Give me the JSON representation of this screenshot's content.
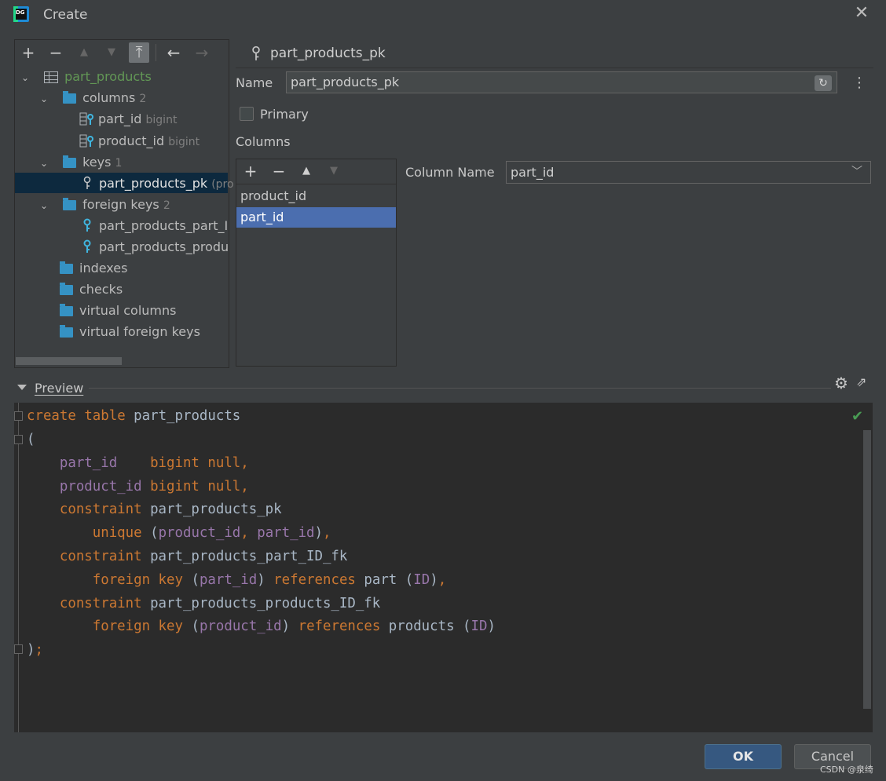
{
  "window": {
    "title": "Create",
    "close_icon": "close-icon"
  },
  "tree": {
    "toolbar": [
      "add-icon",
      "remove-icon",
      "move-up-icon",
      "move-down-icon",
      "pin-icon",
      "back-icon",
      "forward-icon"
    ],
    "root": {
      "label": "part_products"
    },
    "columns": {
      "label": "columns",
      "count": "2",
      "items": [
        {
          "name": "part_id",
          "type": "bigint"
        },
        {
          "name": "product_id",
          "type": "bigint"
        }
      ]
    },
    "keys": {
      "label": "keys",
      "count": "1",
      "items": [
        {
          "name": "part_products_pk",
          "hint": "(pro"
        }
      ]
    },
    "foreign_keys": {
      "label": "foreign keys",
      "count": "2",
      "items": [
        {
          "name": "part_products_part_ID"
        },
        {
          "name": "part_products_produc"
        }
      ]
    },
    "indexes": "indexes",
    "checks": "checks",
    "virtual_columns": "virtual columns",
    "virtual_foreign_keys": "virtual foreign keys"
  },
  "detail": {
    "header": "part_products_pk",
    "name_label": "Name",
    "name_value": "part_products_pk",
    "primary_label": "Primary",
    "primary_checked": false,
    "columns_label": "Columns",
    "columns": [
      "product_id",
      "part_id"
    ],
    "selected_column": "part_id",
    "column_name_label": "Column Name",
    "column_name_value": "part_id"
  },
  "preview": {
    "label": "Preview",
    "colors": {
      "keyword": "#cc7832",
      "column": "#9876aa",
      "text": "#a9b7c6",
      "background": "#2b2b2b"
    },
    "lines": [
      "create table part_products",
      "(",
      "    part_id    bigint null,",
      "    product_id bigint null,",
      "    constraint part_products_pk",
      "        unique (product_id, part_id),",
      "    constraint part_products_part_ID_fk",
      "        foreign key (part_id) references part (ID),",
      "    constraint part_products_products_ID_fk",
      "        foreign key (product_id) references products (ID)",
      ");"
    ]
  },
  "buttons": {
    "ok": "OK",
    "cancel": "Cancel"
  },
  "watermark": "CSDN @泉绮"
}
